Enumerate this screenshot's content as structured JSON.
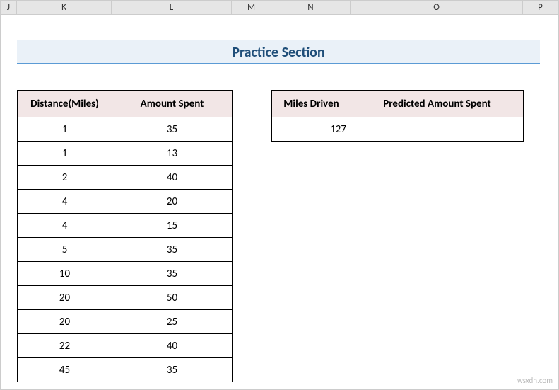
{
  "columns": [
    "J",
    "K",
    "L",
    "M",
    "N",
    "O",
    "P"
  ],
  "title": "Practice Section",
  "table1": {
    "headers": [
      "Distance(Miles)",
      "Amount Spent"
    ],
    "rows": [
      {
        "d": "1",
        "a": "35"
      },
      {
        "d": "1",
        "a": "13"
      },
      {
        "d": "2",
        "a": "40"
      },
      {
        "d": "4",
        "a": "20"
      },
      {
        "d": "4",
        "a": "15"
      },
      {
        "d": "5",
        "a": "35"
      },
      {
        "d": "10",
        "a": "35"
      },
      {
        "d": "20",
        "a": "50"
      },
      {
        "d": "20",
        "a": "25"
      },
      {
        "d": "22",
        "a": "40"
      },
      {
        "d": "45",
        "a": "35"
      }
    ]
  },
  "table2": {
    "headers": [
      "Miles Driven",
      "Predicted Amount Spent"
    ],
    "rows": [
      {
        "m": "127",
        "p": ""
      }
    ]
  },
  "watermark": "wsxdn.com"
}
